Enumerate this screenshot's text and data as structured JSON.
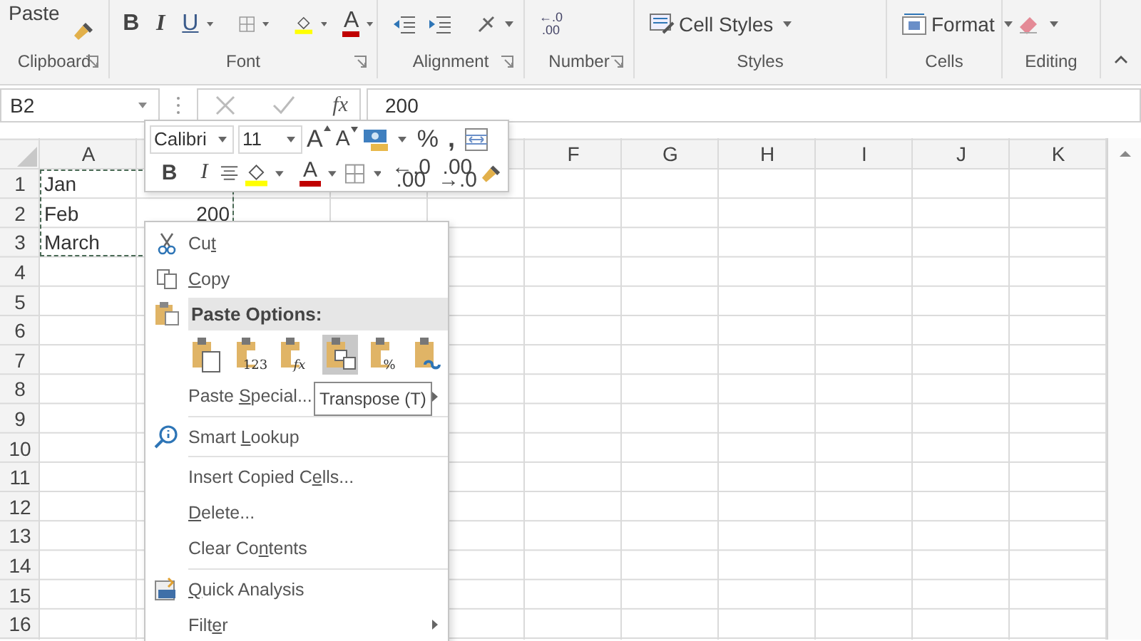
{
  "ribbon": {
    "paste_label": "Paste",
    "font_buttons": [
      "B",
      "I",
      "U"
    ],
    "font_color_letter": "A",
    "decimal_icon": [
      "←.0",
      ".00"
    ],
    "cell_styles": "Cell Styles",
    "format": "Format",
    "groups": [
      {
        "label": "Clipboard",
        "launcher": true
      },
      {
        "label": "Font",
        "launcher": true
      },
      {
        "label": "Alignment",
        "launcher": true
      },
      {
        "label": "Number",
        "launcher": true
      },
      {
        "label": "Styles",
        "launcher": false
      },
      {
        "label": "Cells",
        "launcher": false
      },
      {
        "label": "Editing",
        "launcher": false
      }
    ]
  },
  "formula_bar": {
    "name_box": "B2",
    "function_label": "fx",
    "value": "200"
  },
  "sheet": {
    "columns": [
      "A",
      "F",
      "G",
      "H",
      "I",
      "J",
      "K"
    ],
    "rows": [
      {
        "header": "1",
        "cells": [
          {
            "text": "Jan",
            "kind": "text"
          }
        ]
      },
      {
        "header": "2",
        "cells": [
          {
            "text": "Feb",
            "kind": "text"
          },
          {
            "text": "200",
            "kind": "number"
          }
        ]
      },
      {
        "header": "3",
        "cells": [
          {
            "text": "March",
            "kind": "text"
          }
        ]
      },
      {
        "header": "4"
      },
      {
        "header": "5"
      },
      {
        "header": "6"
      },
      {
        "header": "7"
      },
      {
        "header": "8"
      },
      {
        "header": "9"
      },
      {
        "header": "10"
      },
      {
        "header": "11"
      },
      {
        "header": "12"
      },
      {
        "header": "13"
      },
      {
        "header": "14"
      },
      {
        "header": "15"
      },
      {
        "header": "16"
      }
    ]
  },
  "mini_toolbar": {
    "font": "Calibri",
    "size": "11",
    "grow_letter": "A",
    "shrink_letter": "A",
    "percent": "%",
    "comma": ",",
    "format_buttons": [
      "B",
      "I"
    ],
    "font_color_letter": "A",
    "decimal_icons": [
      [
        "←.0",
        ".00"
      ],
      [
        ".00",
        "→.0"
      ]
    ]
  },
  "context_menu": {
    "tooltip": "Transpose (T)",
    "items": [
      {
        "kind": "command",
        "before": "Cu",
        "key": "t",
        "submenu": false
      },
      {
        "kind": "command",
        "key": "C",
        "after": "opy",
        "submenu": false
      },
      {
        "kind": "header",
        "label": "Paste Options:"
      },
      {
        "kind": "paste_options",
        "options": [
          {
            "selected": false
          },
          {
            "selected": false,
            "glyph": "123"
          },
          {
            "selected": false,
            "glyph": "fx"
          },
          {
            "selected": true
          },
          {
            "selected": false,
            "glyph": "%"
          },
          {
            "selected": false
          }
        ]
      },
      {
        "kind": "command",
        "before": "Paste ",
        "key": "S",
        "after": "pecial...",
        "submenu": true
      },
      {
        "kind": "separator"
      },
      {
        "kind": "command",
        "before": "Smart ",
        "key": "L",
        "after": "ookup",
        "submenu": false
      },
      {
        "kind": "separator"
      },
      {
        "kind": "command",
        "before": "Insert Copied C",
        "key": "e",
        "after": "lls...",
        "submenu": false
      },
      {
        "kind": "command",
        "key": "D",
        "after": "elete...",
        "submenu": false
      },
      {
        "kind": "command",
        "before": "Clear Co",
        "key": "n",
        "after": "tents",
        "submenu": false
      },
      {
        "kind": "separator"
      },
      {
        "kind": "command",
        "key": "Q",
        "after": "uick Analysis",
        "submenu": false
      },
      {
        "kind": "command",
        "before": "Filt",
        "key": "e",
        "after": "r",
        "submenu": true
      }
    ]
  }
}
